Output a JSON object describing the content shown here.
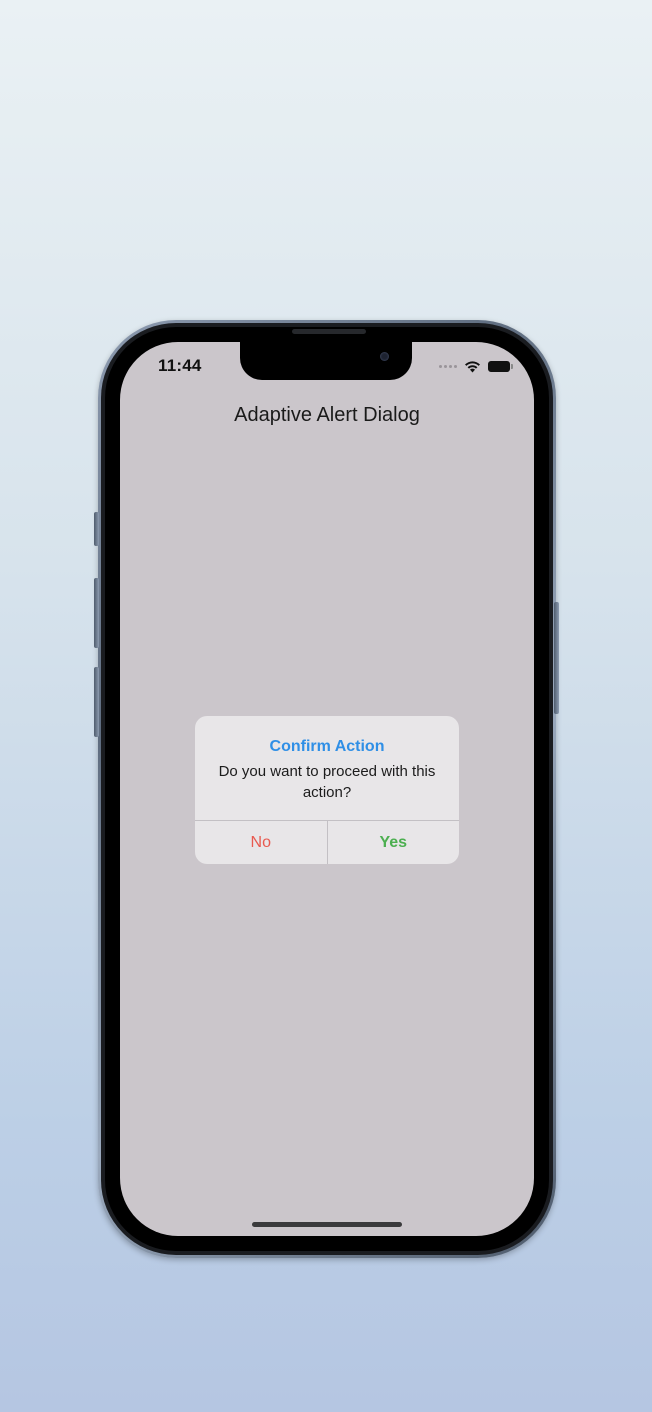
{
  "status_bar": {
    "time": "11:44"
  },
  "app": {
    "title": "Adaptive Alert Dialog"
  },
  "dialog": {
    "title": "Confirm Action",
    "message": "Do you want to proceed with this action?",
    "buttons": {
      "no": "No",
      "yes": "Yes"
    }
  },
  "colors": {
    "dialog_title": "#2f8fe6",
    "no_button": "#e85a50",
    "yes_button": "#4caf50",
    "screen_background": "#cbc6cb"
  }
}
